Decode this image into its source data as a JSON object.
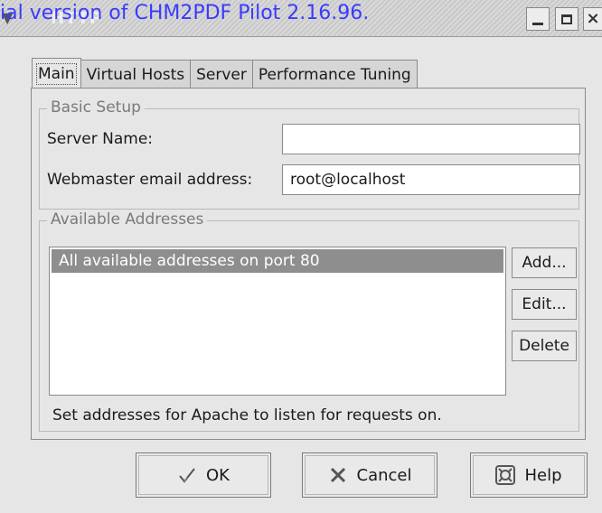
{
  "window": {
    "title": "HTTP",
    "watermark": "ial version of CHM2PDF Pilot 2.16.96."
  },
  "tabs": [
    {
      "label": "Main"
    },
    {
      "label": "Virtual Hosts"
    },
    {
      "label": "Server"
    },
    {
      "label": "Performance Tuning"
    }
  ],
  "basic_setup": {
    "title": "Basic Setup",
    "server_name_label": "Server Name:",
    "server_name_value": "",
    "webmaster_label": "Webmaster email address:",
    "webmaster_value": "root@localhost"
  },
  "addresses": {
    "title": "Available Addresses",
    "items": [
      "All available addresses on port 80"
    ],
    "add_label": "Add...",
    "edit_label": "Edit...",
    "delete_label": "Delete",
    "hint": "Set addresses for Apache to listen for requests on."
  },
  "buttons": {
    "ok_label": "OK",
    "cancel_label": "Cancel",
    "help_label": "Help"
  }
}
